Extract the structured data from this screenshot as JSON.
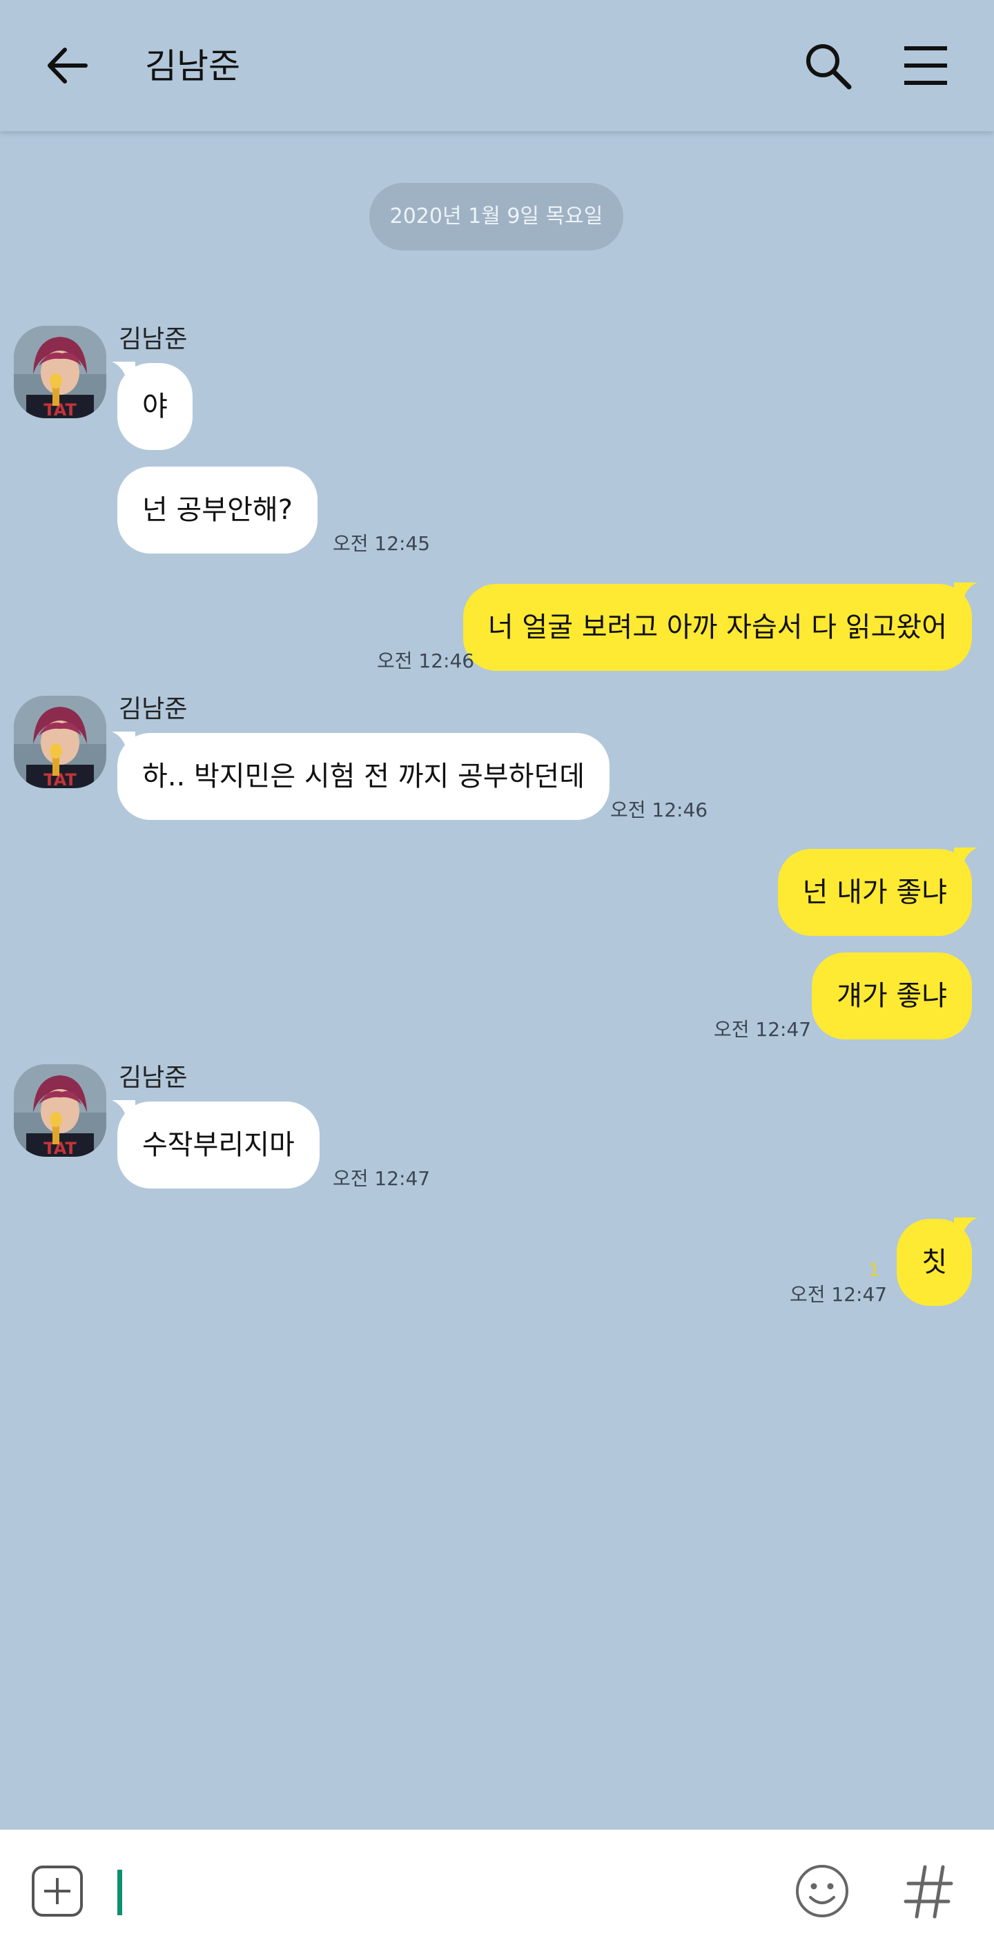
{
  "header": {
    "title": "김남준"
  },
  "date_divider": "2020년 1월 9일 목요일",
  "sender_name": "김남준",
  "messages": [
    {
      "text": "야",
      "direction": "in"
    },
    {
      "text": "넌 공부안해?",
      "direction": "in",
      "time": "오전 12:45"
    },
    {
      "text": "너 얼굴 보려고 아까 자습서 다 읽고왔어",
      "direction": "out",
      "time": "오전 12:46"
    },
    {
      "text": "하.. 박지민은 시험 전 까지 공부하던데",
      "direction": "in",
      "time": "오전 12:46"
    },
    {
      "text": "넌 내가 좋냐",
      "direction": "out"
    },
    {
      "text": "걔가 좋냐",
      "direction": "out",
      "time": "오전 12:47"
    },
    {
      "text": "수작부리지마",
      "direction": "in",
      "time": "오전 12:47"
    },
    {
      "text": "칫",
      "direction": "out",
      "time": "오전 12:47",
      "unread": "1"
    }
  ],
  "colors": {
    "background": "#b2c7da",
    "incoming_bubble": "#ffffff",
    "outgoing_bubble": "#fee933",
    "cursor": "#0e8f6e"
  },
  "icons": {
    "back": "arrow-left",
    "search": "magnifier",
    "menu": "hamburger",
    "attach": "plus-square",
    "emoji": "smiley",
    "hashtag": "hash"
  }
}
